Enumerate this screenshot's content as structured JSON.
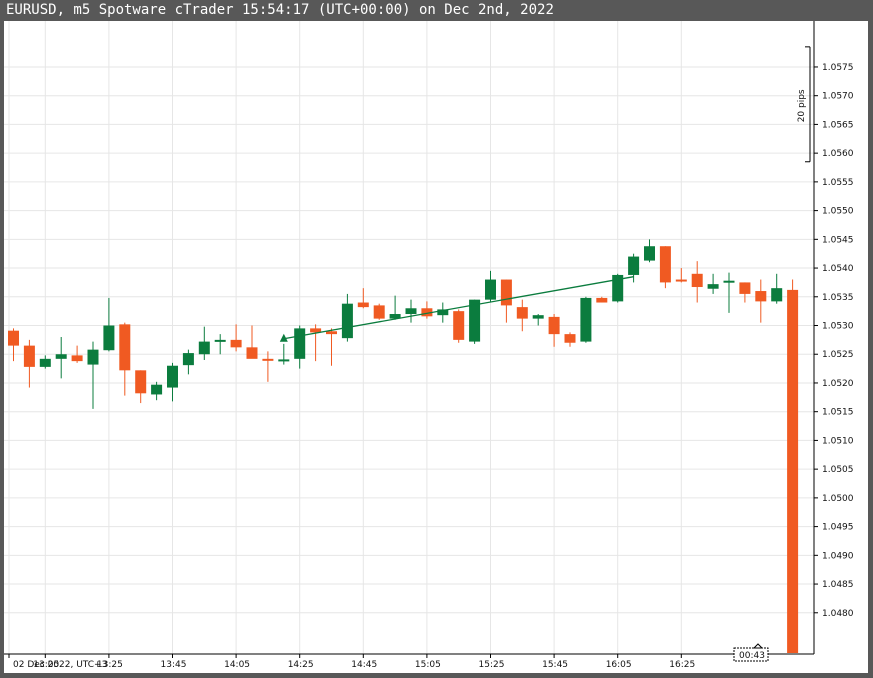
{
  "window": {
    "title": "EURUSD, m5 Spotware cTrader 15:54:17 (UTC+00:00) on Dec 2nd, 2022"
  },
  "colors": {
    "bull": "#0b7c3e",
    "bear": "#f05a22",
    "grid": "#e6e6e6",
    "frame": "#585858",
    "axis_text": "#111111"
  },
  "countdown": "00:43",
  "ruler_label": "20 pips",
  "chart_data": {
    "type": "candlestick",
    "symbol": "EURUSD",
    "timeframe": "m5",
    "x_tick_labels": [
      "02 Dec 2022, UTC+3",
      "13:05",
      "13:25",
      "13:45",
      "14:05",
      "14:25",
      "14:45",
      "15:05",
      "15:25",
      "15:45",
      "16:05",
      "16:25"
    ],
    "y_tick_labels": [
      "1.0575",
      "1.0570",
      "1.0565",
      "1.0560",
      "1.0555",
      "1.0550",
      "1.0545",
      "1.0540",
      "1.0535",
      "1.0530",
      "1.0525",
      "1.0520",
      "1.0515",
      "1.0510",
      "1.0505",
      "1.0500",
      "1.0495",
      "1.0490",
      "1.0485",
      "1.0480"
    ],
    "ylim": [
      1.0473,
      1.0583
    ],
    "grid": true,
    "candles": [
      {
        "time": "12:40",
        "open": 1.05291,
        "high": 1.05295,
        "low": 1.05238,
        "close": 1.05265
      },
      {
        "time": "12:45",
        "open": 1.05265,
        "high": 1.05275,
        "low": 1.05192,
        "close": 1.05228
      },
      {
        "time": "12:50",
        "open": 1.05228,
        "high": 1.05248,
        "low": 1.05225,
        "close": 1.05242
      },
      {
        "time": "12:55",
        "open": 1.05242,
        "high": 1.0528,
        "low": 1.05208,
        "close": 1.0525
      },
      {
        "time": "13:00",
        "open": 1.05248,
        "high": 1.05265,
        "low": 1.05235,
        "close": 1.05238
      },
      {
        "time": "13:05",
        "open": 1.05232,
        "high": 1.05272,
        "low": 1.05155,
        "close": 1.05258
      },
      {
        "time": "13:10",
        "open": 1.05257,
        "high": 1.05348,
        "low": 1.05255,
        "close": 1.053
      },
      {
        "time": "13:15",
        "open": 1.05302,
        "high": 1.05305,
        "low": 1.05178,
        "close": 1.05222
      },
      {
        "time": "13:20",
        "open": 1.05222,
        "high": 1.05222,
        "low": 1.05165,
        "close": 1.05182
      },
      {
        "time": "13:25",
        "open": 1.0518,
        "high": 1.05202,
        "low": 1.0517,
        "close": 1.05197
      },
      {
        "time": "13:30",
        "open": 1.05192,
        "high": 1.05235,
        "low": 1.05168,
        "close": 1.0523
      },
      {
        "time": "13:35",
        "open": 1.05231,
        "high": 1.05258,
        "low": 1.05215,
        "close": 1.05252
      },
      {
        "time": "13:40",
        "open": 1.0525,
        "high": 1.05298,
        "low": 1.0524,
        "close": 1.05272
      },
      {
        "time": "13:45",
        "open": 1.05272,
        "high": 1.05285,
        "low": 1.0525,
        "close": 1.05275
      },
      {
        "time": "13:50",
        "open": 1.05275,
        "high": 1.05302,
        "low": 1.05255,
        "close": 1.05262
      },
      {
        "time": "13:55",
        "open": 1.05262,
        "high": 1.053,
        "low": 1.05245,
        "close": 1.05242
      },
      {
        "time": "14:00",
        "open": 1.05242,
        "high": 1.05255,
        "low": 1.05202,
        "close": 1.0524
      },
      {
        "time": "14:05",
        "open": 1.0524,
        "high": 1.05268,
        "low": 1.05232,
        "close": 1.05241
      },
      {
        "time": "14:10",
        "open": 1.05242,
        "high": 1.053,
        "low": 1.05225,
        "close": 1.05295
      },
      {
        "time": "14:15",
        "open": 1.05295,
        "high": 1.05302,
        "low": 1.05238,
        "close": 1.05288
      },
      {
        "time": "14:20",
        "open": 1.0529,
        "high": 1.05295,
        "low": 1.0523,
        "close": 1.05285
      },
      {
        "time": "14:25",
        "open": 1.05278,
        "high": 1.05355,
        "low": 1.05272,
        "close": 1.05338
      },
      {
        "time": "14:30",
        "open": 1.0534,
        "high": 1.05365,
        "low": 1.0533,
        "close": 1.05332
      },
      {
        "time": "14:35",
        "open": 1.05335,
        "high": 1.05338,
        "low": 1.0531,
        "close": 1.05312
      },
      {
        "time": "14:40",
        "open": 1.05312,
        "high": 1.05352,
        "low": 1.0531,
        "close": 1.0532
      },
      {
        "time": "14:45",
        "open": 1.0532,
        "high": 1.05345,
        "low": 1.05305,
        "close": 1.0533
      },
      {
        "time": "14:50",
        "open": 1.0533,
        "high": 1.05342,
        "low": 1.05312,
        "close": 1.05316
      },
      {
        "time": "14:55",
        "open": 1.05318,
        "high": 1.0534,
        "low": 1.05305,
        "close": 1.05328
      },
      {
        "time": "15:00",
        "open": 1.05325,
        "high": 1.05328,
        "low": 1.0527,
        "close": 1.05275
      },
      {
        "time": "15:05",
        "open": 1.05272,
        "high": 1.05345,
        "low": 1.05268,
        "close": 1.05345
      },
      {
        "time": "15:10",
        "open": 1.05345,
        "high": 1.05395,
        "low": 1.0534,
        "close": 1.0538
      },
      {
        "time": "15:15",
        "open": 1.0538,
        "high": 1.0538,
        "low": 1.05305,
        "close": 1.05335
      },
      {
        "time": "15:20",
        "open": 1.05332,
        "high": 1.05345,
        "low": 1.0529,
        "close": 1.05312
      },
      {
        "time": "15:25",
        "open": 1.05312,
        "high": 1.0532,
        "low": 1.053,
        "close": 1.05318
      },
      {
        "time": "15:30",
        "open": 1.05315,
        "high": 1.0532,
        "low": 1.05263,
        "close": 1.05285
      },
      {
        "time": "15:35",
        "open": 1.05285,
        "high": 1.05288,
        "low": 1.05263,
        "close": 1.0527
      },
      {
        "time": "15:40",
        "open": 1.05272,
        "high": 1.0535,
        "low": 1.0527,
        "close": 1.05348
      },
      {
        "time": "15:45",
        "open": 1.05348,
        "high": 1.0535,
        "low": 1.0534,
        "close": 1.0534
      },
      {
        "time": "15:50",
        "open": 1.05342,
        "high": 1.0539,
        "low": 1.0534,
        "close": 1.05388
      },
      {
        "time": "15:55",
        "open": 1.05388,
        "high": 1.05425,
        "low": 1.05375,
        "close": 1.0542
      },
      {
        "time": "16:00",
        "open": 1.05413,
        "high": 1.0545,
        "low": 1.0541,
        "close": 1.05438
      },
      {
        "time": "16:05",
        "open": 1.05438,
        "high": 1.05438,
        "low": 1.05365,
        "close": 1.05375
      },
      {
        "time": "16:10",
        "open": 1.0538,
        "high": 1.054,
        "low": 1.05375,
        "close": 1.05378
      },
      {
        "time": "16:15",
        "open": 1.0539,
        "high": 1.05412,
        "low": 1.0534,
        "close": 1.05367
      },
      {
        "time": "16:20",
        "open": 1.05364,
        "high": 1.0539,
        "low": 1.05355,
        "close": 1.05372
      },
      {
        "time": "16:25",
        "open": 1.05375,
        "high": 1.05392,
        "low": 1.05322,
        "close": 1.05378
      },
      {
        "time": "16:30",
        "open": 1.05375,
        "high": 1.05375,
        "low": 1.0534,
        "close": 1.05355
      },
      {
        "time": "16:35",
        "open": 1.0536,
        "high": 1.0538,
        "low": 1.05305,
        "close": 1.05342
      },
      {
        "time": "16:40",
        "open": 1.05342,
        "high": 1.0539,
        "low": 1.05338,
        "close": 1.05365
      },
      {
        "time": "16:45",
        "open": 1.05362,
        "high": 1.0538,
        "low": 1.0473,
        "close": 1.0473
      }
    ],
    "trend_line": {
      "from": {
        "time": "14:05",
        "price": 1.05277
      },
      "to": {
        "time": "15:55",
        "price": 1.05385
      }
    },
    "ruler": {
      "from": 1.05785,
      "to": 1.05585
    }
  }
}
